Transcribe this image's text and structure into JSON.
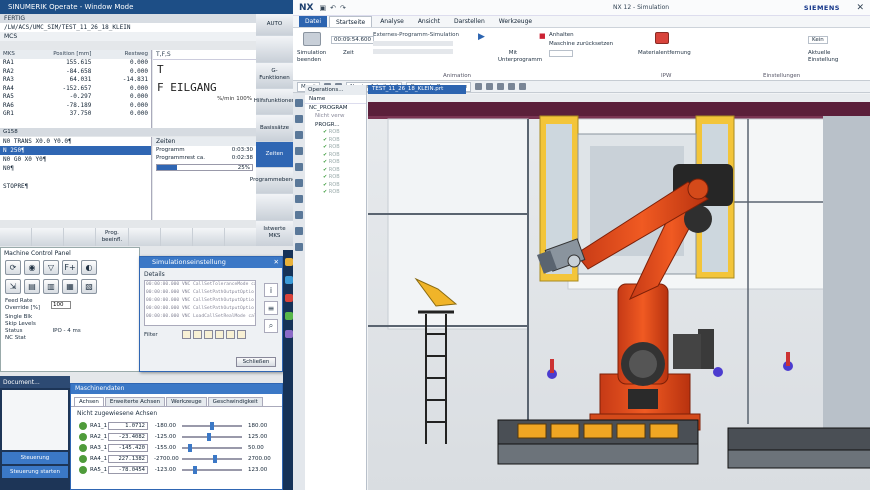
{
  "sinumerik": {
    "window_title": "SINUMERIK Operate - Window Mode",
    "status": "FERTIG",
    "path": "/LW/ACS/UMC_SIM/TEST_11_26_18_KLEIN",
    "mode": "MCS",
    "positions": {
      "headers": [
        "MKS",
        "Position [mm]",
        "Restweg"
      ],
      "rows": [
        [
          "RA1",
          "155.615",
          "0.000"
        ],
        [
          "RA2",
          "-84.658",
          "0.000"
        ],
        [
          "RA3",
          "64.031",
          "-14.831"
        ],
        [
          "RA4",
          "-152.657",
          "0.000"
        ],
        [
          "RA5",
          "-0.297",
          "0.000"
        ],
        [
          "RA6",
          "-78.189",
          "0.000"
        ],
        [
          "GR1",
          "37.750",
          "0.000"
        ]
      ]
    },
    "feed": {
      "header": "T,F,S",
      "tool": "T",
      "feed": "F    EILGANG",
      "unit": "%/min  100%"
    },
    "footer": "G158",
    "program": {
      "lines": [
        "N0 TRANS X0.0 Y0.0¶",
        "N 250¶",
        "N0 G0 X0 Y0¶",
        "N0¶",
        "",
        "STOPRE¶"
      ],
      "highlight_index": 1
    },
    "times": {
      "title": "Zeiten",
      "program_label": "Programm",
      "program_value": "0:03:30",
      "rest_label": "Programmrest ca.",
      "rest_value": "0:02:38",
      "progress_label": "25%",
      "progress": 0.25
    },
    "hsoft": [
      "",
      "",
      "",
      "Prog. beeinfl.",
      "",
      "",
      "",
      ""
    ],
    "vsoft": [
      {
        "label": "",
        "active": false
      },
      {
        "label": "G-Funktionen",
        "active": false
      },
      {
        "label": "Hilfsfunktionen",
        "active": false
      },
      {
        "label": "Basissätze",
        "active": false
      },
      {
        "label": "Zeiten",
        "active": true
      },
      {
        "label": "Programmebenen",
        "active": false
      },
      {
        "label": "",
        "active": false
      },
      {
        "label": "Istwerte MKS",
        "active": false
      }
    ],
    "vsoft_header": "AUTO"
  },
  "mcp": {
    "title": "Machine Control Panel",
    "feed_label": "Feed Rate Override [%]",
    "feed_value": "100",
    "single_block": "Single Blk",
    "skip_levels": "Skip Levels",
    "status_label": "Status",
    "status_value": "IPO - 4 ms",
    "nc_state": "NC Stat"
  },
  "sim_dialog": {
    "title": "Simulationseinstellung",
    "details_label": "Details",
    "log": [
      "00:00:00.000 VNC CallSetToleranceMode calle",
      "00:00:00.000 VNC CallSetPathOutputOptio",
      "00:00:00.000 VNC CallSetPathOutputOptio",
      "00:00:00.000 VNC CallSetPathOutputOptio",
      "00:00:00.000 VNC LoadCallSetRealMode called"
    ],
    "filter_label": "Filter",
    "close_label": "Schließen"
  },
  "axes": {
    "title": "Maschinendaten",
    "tabs": [
      "Achsen",
      "Erweiterte Achsen",
      "Werkzeuge",
      "Geschwindigkeit"
    ],
    "active_tab": 0,
    "subtitle": "Nicht zugewiesene Achsen",
    "rows": [
      {
        "name": "RA1_1",
        "value": "1.0712",
        "min": "-180.00",
        "max": "180.00",
        "pos": 0.5
      },
      {
        "name": "RA2_1",
        "value": "-23.4082",
        "min": "-125.00",
        "max": "125.00",
        "pos": 0.45
      },
      {
        "name": "RA3_1",
        "value": "-145.420",
        "min": "-155.00",
        "max": "50.00",
        "pos": 0.1
      },
      {
        "name": "RA4_1",
        "value": "227.1382",
        "min": "-2700.00",
        "max": "2700.00",
        "pos": 0.55
      },
      {
        "name": "RA5_1",
        "value": "-78.0454",
        "min": "-123.00",
        "max": "123.00",
        "pos": 0.2
      }
    ]
  },
  "sim_output": {
    "title": "Document...",
    "btn1": "Steuerung",
    "btn2": "Steuerung starten"
  },
  "nx": {
    "logo": "NX",
    "title": "NX 12 - Simulation",
    "brand": "SIEMENS",
    "menus": [
      "Datei",
      "Startseite",
      "Analyse",
      "Ansicht",
      "Darstellen",
      "Werkzeuge"
    ],
    "active_menu": 0,
    "current_menu": 1,
    "ribbon": {
      "sim_end": "Simulation beenden",
      "time_label": "Zeit",
      "time_value": "00:09:54.600",
      "ext_sim": "Externes-Programm-Simulation",
      "mit_unterprog": "Mit Unterprogramm",
      "anhalten": "Anhalten",
      "maschine_zurueck": "Maschine zurücksetzen",
      "animation_group": "Animation",
      "mat_entfernung": "Materialentfernung",
      "ipw_group": "IPW",
      "mm_unit": "Kein",
      "aktuelle_einst": "Aktuelle Einstellung",
      "einstellungen_group": "Einstellungen"
    },
    "menu_btn": "Menü",
    "toolbar_drop1": "Nur im Arbeitsteil",
    "toolbar_drop2": "Gesamte Baugruppe",
    "navigator": {
      "title": "Operations...",
      "header": "Name",
      "root": "NC_PROGRAM",
      "unused": "Nicht verw",
      "prog": "PROGR...",
      "ops": [
        "ROB",
        "ROB",
        "ROB",
        "ROB",
        "ROB",
        "ROB",
        "ROB",
        "ROB",
        "ROB"
      ]
    },
    "graphics_tab": "TEST_11_26_18_KLEIN.prt"
  }
}
